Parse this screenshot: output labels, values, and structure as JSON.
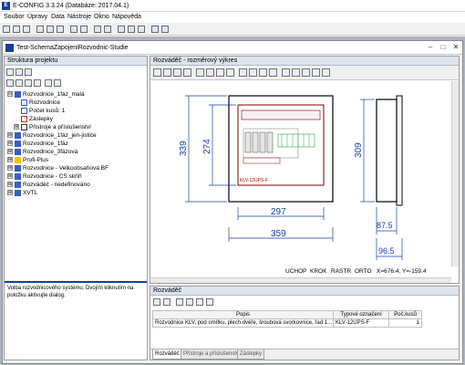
{
  "app": {
    "title": "E-CONFIG 3.3.24  (Databáze: 2017.04.1)"
  },
  "menu": [
    "Soubor",
    "Úpravy",
    "Data",
    "Nástroje",
    "Okno",
    "Nápověda"
  ],
  "document": {
    "title": "Test-SchemaZapojeniRozvodnic-Studie"
  },
  "project_panel": {
    "title": "Struktura projektu",
    "tree": [
      {
        "label": "Rozvodnice_1fáz_malá",
        "expanded": "⊟"
      },
      {
        "label": "Rozvodnice"
      },
      {
        "label": "Počet kusů: 1"
      },
      {
        "label": "Záslepky"
      },
      {
        "label": "Přístroje a příslušenství",
        "expanded": "⊞"
      },
      {
        "label": "Rozvodnice_1fáz_jen-jističe",
        "expanded": "⊞"
      },
      {
        "label": "Rozvodnice_1fáz",
        "expanded": "⊞"
      },
      {
        "label": "Rozvodnice_3fázová",
        "expanded": "⊞"
      },
      {
        "label": "Profi-Plus",
        "expanded": "⊞"
      },
      {
        "label": "Rozvodnice - Velkoobsahová BF",
        "expanded": "⊞"
      },
      {
        "label": "Rozvodnice - CS skříň",
        "expanded": "⊞"
      },
      {
        "label": "Rozváděč - nedefinováno",
        "expanded": "⊞"
      },
      {
        "label": "XVTL",
        "expanded": "⊞"
      }
    ],
    "info": "Volba rozvodnicového systému. Dvojím kliknutím na položku aktivujte dialog."
  },
  "drawing": {
    "title": "Rozváděč - rozměrový výkres",
    "dims": {
      "width_inner": "297",
      "width_outer": "359",
      "height_outer": "339",
      "height_inner": "274",
      "depth_height": "309",
      "depth_1": "87.5",
      "depth_2": "96.5"
    },
    "part_label": "KLV-12UPS-F",
    "status": {
      "uchop": "UCHOP",
      "krok": "KROK",
      "rastr": "RASTR",
      "orto": "ORTO",
      "coords": "X=676.4,  Y=-159.4"
    }
  },
  "bottom": {
    "title": "Rozváděč",
    "columns": [
      "Popis",
      "Typové označení",
      "Poč.kusů"
    ],
    "rows": [
      [
        "Rozvodnice KLV, pod omítku, plech dvéře, šroubová svorkovnice, řad 1...",
        "KLV-12UPS-F",
        "1"
      ]
    ],
    "tabs": [
      "Rozváděč",
      "Přístroje a příslušenství",
      "Záslepky"
    ]
  },
  "colors": {
    "accent": "#1a3f9a",
    "drawing_line": "#7a0000",
    "dim_line": "#1a3fa8"
  }
}
